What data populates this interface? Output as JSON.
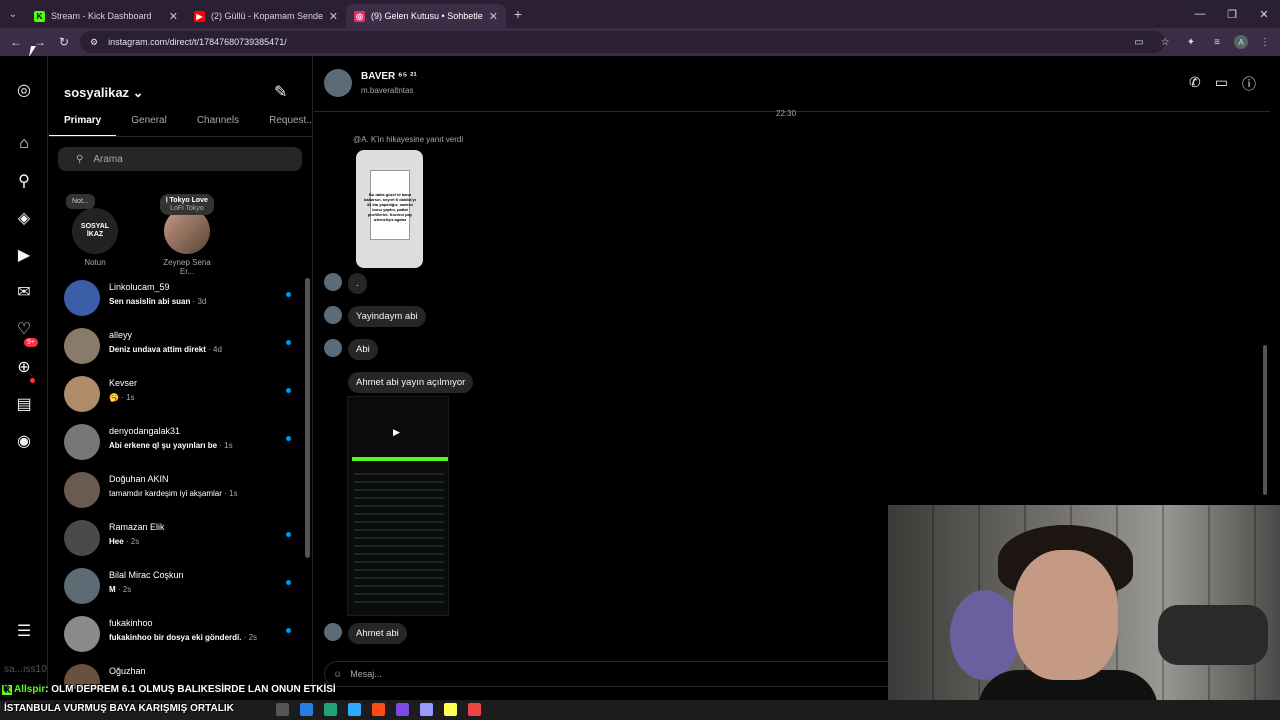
{
  "browser": {
    "tabs": [
      {
        "title": "Stream - Kick Dashboard",
        "favicon": "K",
        "color": "#53fc18"
      },
      {
        "title": "(2) Güllü - Kopamam Senden -",
        "favicon": "▶",
        "color": "#ff0000"
      },
      {
        "title": "(9) Gelen Kutusu • Sohbetler",
        "favicon": "◎",
        "color": "#e1306c"
      }
    ],
    "url": "instagram.com/direct/t/17847680739385471/"
  },
  "sidebar": {
    "username": "sosyalikaz",
    "tabs": [
      "Primary",
      "General",
      "Channels",
      "Request..."
    ],
    "search_placeholder": "Arama",
    "notifications_badge": "9+",
    "notes": [
      {
        "bubble": "Not...",
        "avatar_text": "SOSYAL İKAZ",
        "label": "Notun"
      },
      {
        "bubble_title": "Tokyo Love",
        "bubble_sub": "LoFi Tokyo",
        "label": "Zeynep Sena Er..."
      }
    ],
    "threads": [
      {
        "name": "Linkolucam_59",
        "preview": "Sen nasislin abi suan",
        "time": " · 3d",
        "avatar": "#3b5ea8"
      },
      {
        "name": "alleyy",
        "preview": "Deniz undava attim direkt",
        "time": " · 4d",
        "avatar": "#8a7a6a"
      },
      {
        "name": "Kevser",
        "preview": "🥱",
        "time": " · 1s",
        "avatar": "#b08b6a"
      },
      {
        "name": "denyodangalak31",
        "preview": "Abi erkene ql şu yayınları be",
        "time": " · 1s",
        "avatar": "#777"
      },
      {
        "name": "Doğuhan AKIN",
        "preview": "tamamdır kardeşim iyi akşamlar",
        "time": " · 1s",
        "avatar": "#6b5a4f"
      },
      {
        "name": "Ramazan Elik",
        "preview": "Hee",
        "time": " · 2s",
        "avatar": "#4a4a4a"
      },
      {
        "name": "Bilal Mirac Coşkun",
        "preview": "M",
        "time": " · 2s",
        "avatar": "#5d6b74"
      },
      {
        "name": "fukakinhoo",
        "preview": "fukakinhoo bir dosya eki gönderdi.",
        "time": " · 2s",
        "avatar": "#8a8a8a"
      },
      {
        "name": "Oğuzhan",
        "preview": "",
        "time": "",
        "avatar": "#6a5040"
      }
    ]
  },
  "chat": {
    "name": "BAVER ⁶⁵ ²¹",
    "handle": "m.baveraltntas",
    "timestamp": "22:30",
    "replied_label": "@A. K'in hikayesine yanıt verdi",
    "story_text": "Bu daha güzel bi bana bakarsın, seyret ti dakika'yı 43 kta yapıldığız, sadece bunu yaptın, patlat profillerini. Kontrol pay izlemeliyiz agalar",
    "messages": [
      ".",
      "Yayindaym abi",
      "Abi",
      "Ahmet abi yayın açılmıyor",
      "Ahmet abi"
    ],
    "input_placeholder": "Mesaj..."
  },
  "overlay": {
    "chat_user": "Allspir",
    "chat_text": ": OLM DEPREM 6.1 OLMUŞ BALIKESİRDE LAN ONUN ETKİSİ",
    "chat_text2": "İSTANBULA VURMUŞ BAYA KARIŞMIŞ ORTALIK",
    "watermark": "sa...ıss10"
  }
}
